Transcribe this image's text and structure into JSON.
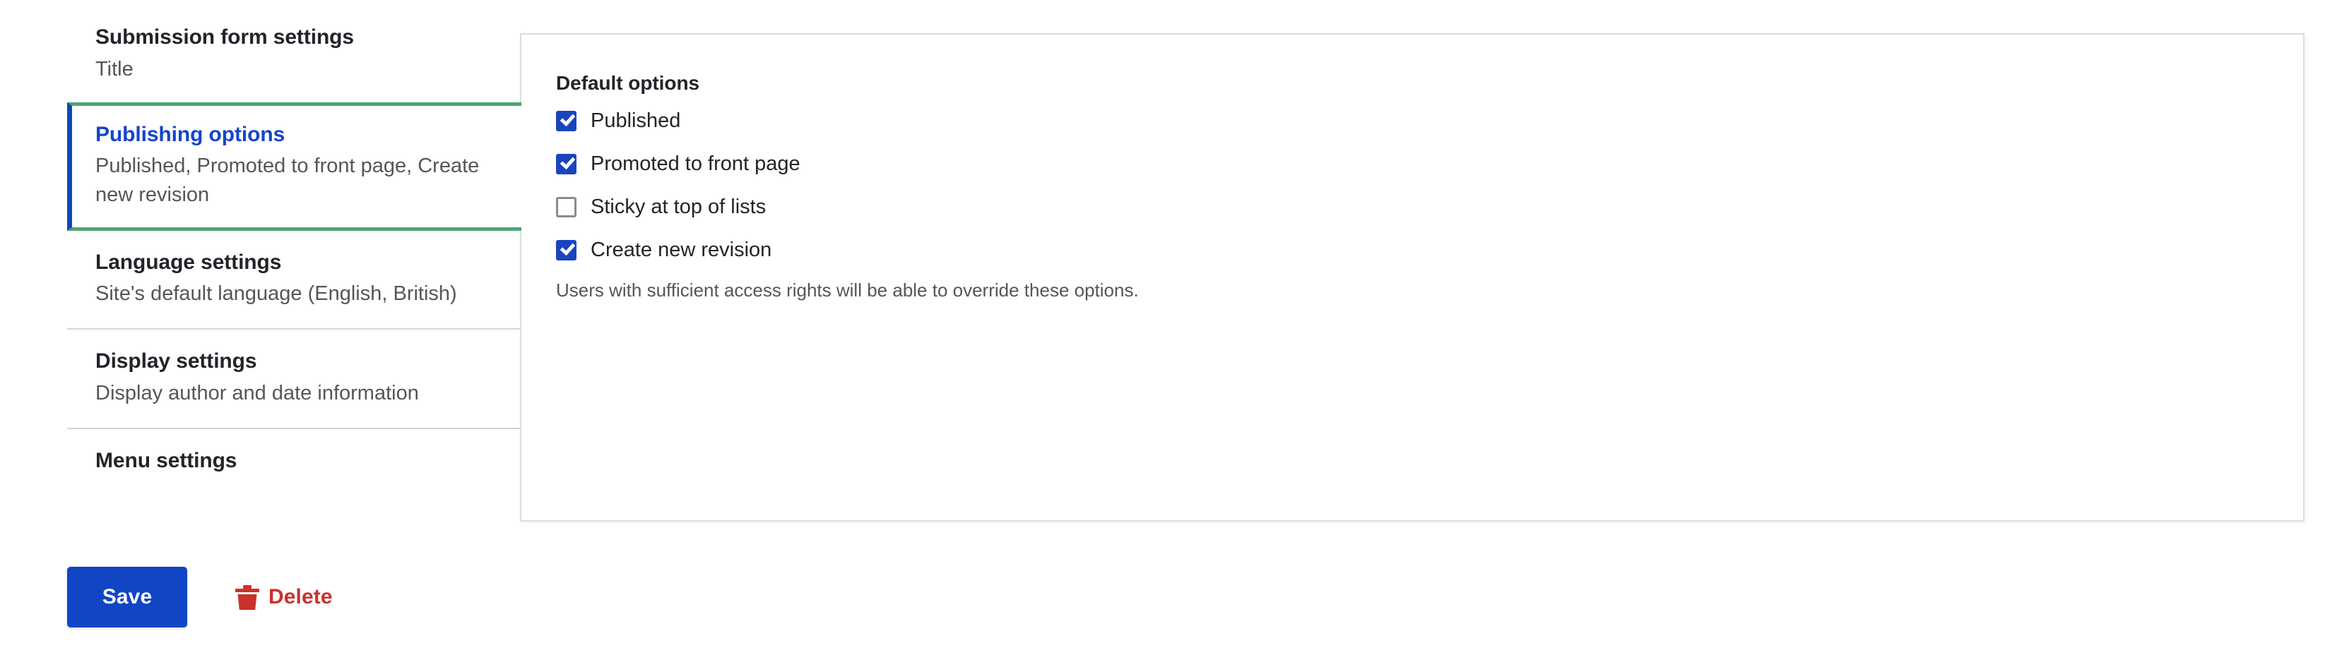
{
  "colors": {
    "accent_blue": "#1145c4",
    "active_tab_title": "#1645c9",
    "active_tab_left_border": "#0f47b8",
    "active_tab_edge_green": "#4ea572",
    "checkbox_checked": "#1845bd",
    "checkbox_border": "#8a8c91",
    "delete_red": "#c9322b",
    "text_primary": "#232429",
    "text_secondary": "#55565b",
    "panel_border": "#dcdce3",
    "divider": "#d4d4da"
  },
  "vertical_tabs": {
    "items": [
      {
        "title": "Submission form settings",
        "summary": "Title",
        "active": false
      },
      {
        "title": "Publishing options",
        "summary": "Published, Promoted to front page, Create new revision",
        "active": true
      },
      {
        "title": "Language settings",
        "summary": "Site's default language (English, British)",
        "active": false
      },
      {
        "title": "Display settings",
        "summary": "Display author and date information",
        "active": false
      },
      {
        "title": "Menu settings",
        "summary": "",
        "active": false
      }
    ]
  },
  "panel": {
    "heading": "Default options",
    "checkboxes": [
      {
        "label": "Published",
        "checked": true
      },
      {
        "label": "Promoted to front page",
        "checked": true
      },
      {
        "label": "Sticky at top of lists",
        "checked": false
      },
      {
        "label": "Create new revision",
        "checked": true
      }
    ],
    "help_text": "Users with sufficient access rights will be able to override these options."
  },
  "actions": {
    "save_label": "Save",
    "delete_label": "Delete",
    "delete_icon": "trash-icon"
  }
}
